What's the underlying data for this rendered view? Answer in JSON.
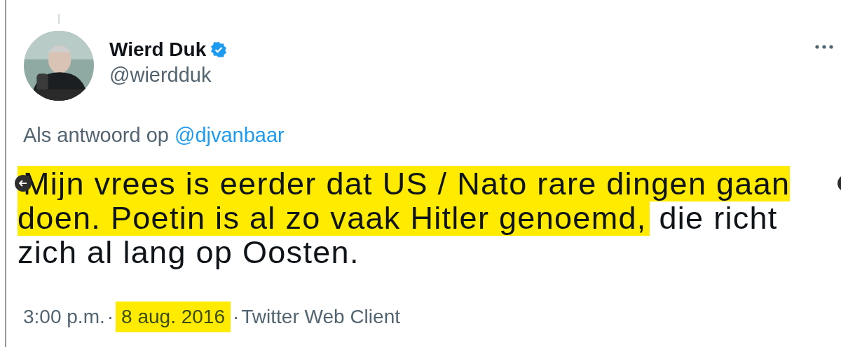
{
  "tweet": {
    "author": {
      "name": "Wierd Duk",
      "verified": true,
      "handle": "@wierdduk"
    },
    "reply_to": {
      "label": "Als antwoord op",
      "mention": "@djvanbaar"
    },
    "text": [
      {
        "text": "Mijn vrees is eerder dat US / Nato rare dingen gaan doen. Poetin is al zo vaak Hitler genoemd,",
        "highlighted": true
      },
      {
        "text": " die richt zich al lang op Oosten.",
        "highlighted": false
      }
    ],
    "footer": [
      {
        "kind": "time",
        "text": "3:00 p.m.",
        "highlighted": false
      },
      {
        "kind": "separator",
        "text": "·"
      },
      {
        "kind": "date",
        "text": "8 aug. 2016",
        "highlighted": true
      },
      {
        "kind": "separator",
        "text": "·"
      },
      {
        "kind": "source",
        "text": "Twitter Web Client",
        "highlighted": false
      }
    ]
  }
}
